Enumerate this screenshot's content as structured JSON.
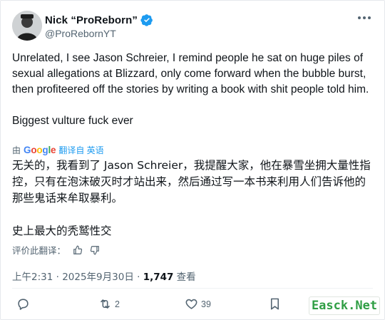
{
  "author": {
    "display_name": "Nick “ProReborn”",
    "handle": "@ProRebornYT",
    "verified": true
  },
  "tweet": {
    "text": "Unrelated, I see Jason Schreier, I remind people he sat on huge piles of sexual allegations at Blizzard, only come forward when the bubble burst, then profiteered off the stories by writing a book with shit people told him.\n\nBiggest vulture fuck ever"
  },
  "translation": {
    "prefix": "由",
    "provider_letters": [
      "G",
      "o",
      "o",
      "g",
      "l",
      "e"
    ],
    "link": "翻译自 英语",
    "text": "无关的，我看到了 Jason Schreier，我提醒大家，他在暴雪坐拥大量性指控，只有在泡沫破灭时才站出来，然后通过写一本书来利用人们告诉他的那些鬼话来牟取暴利。\n\n史上最大的秃鹫性交",
    "rate_label": "评价此翻译："
  },
  "meta": {
    "timestamp": "上午2:31 · 2025年9月30日 · ",
    "views_count": "1,747",
    "views_label": " 查看"
  },
  "actions": {
    "reply_count": "",
    "retweet_count": "2",
    "like_count": "39"
  },
  "watermark": "Easck.Net",
  "colors": {
    "accent": "#1d9bf0",
    "secondary_text": "#536471",
    "watermark": "#2f9e44"
  }
}
